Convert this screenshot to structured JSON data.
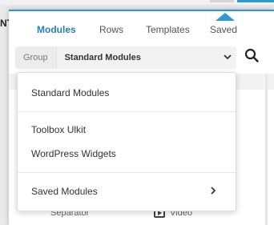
{
  "background": {
    "left_edge_text": "NT"
  },
  "tabs": [
    {
      "label": "Modules",
      "active": true
    },
    {
      "label": "Rows",
      "active": false
    },
    {
      "label": "Templates",
      "active": false
    },
    {
      "label": "Saved",
      "active": false
    }
  ],
  "group_select": {
    "label": "Group",
    "value": "Standard Modules",
    "chevron_icon": "chevron-down-icon"
  },
  "search": {
    "icon": "search-icon"
  },
  "dropdown": {
    "items": [
      {
        "label": "Standard Modules"
      },
      {
        "label": "Toolbox Ulkit"
      },
      {
        "label": "WordPress Widgets"
      },
      {
        "label": "Saved Modules",
        "has_submenu": true
      }
    ],
    "submenu_icon": "chevron-right-icon"
  },
  "peek_list": {
    "separator_label": "Separator",
    "video_label": "Video"
  },
  "colors": {
    "accent": "#2c9ad1",
    "active_tab": "#2a7fb6"
  }
}
